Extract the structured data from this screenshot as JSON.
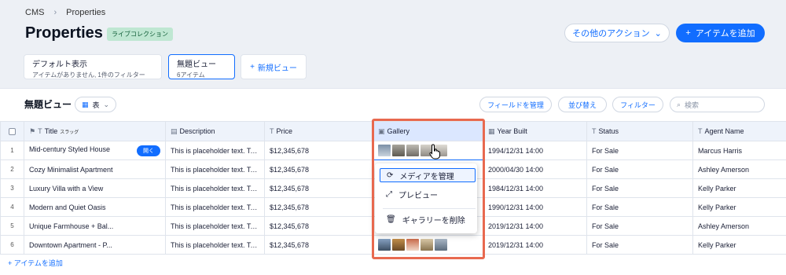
{
  "breadcrumb": [
    "CMS",
    "Properties"
  ],
  "page_title": "Properties",
  "badge": "ライブコレクション",
  "more_actions": "その他のアクション",
  "add_item": "アイテムを追加",
  "views": {
    "default": {
      "title": "デフォルト表示",
      "subtitle": "アイテムがありません, 1件のフィルター"
    },
    "current": {
      "title": "無題ビュー",
      "subtitle": "6アイテム"
    },
    "new_view": "新規ビュー"
  },
  "toolbar": {
    "view_name": "無題ビュー",
    "view_type": "表",
    "manage_fields": "フィールドを管理",
    "sort": "並び替え",
    "filter": "フィルター",
    "search_placeholder": "検索"
  },
  "columns": {
    "title": "Title",
    "slug": "スラッグ",
    "description": "Description",
    "price": "Price",
    "gallery": "Gallery",
    "year_built": "Year Built",
    "status": "Status",
    "agent_name": "Agent Name"
  },
  "rows": [
    {
      "num": "1",
      "title": "Mid-century Styled House",
      "description": "This is placeholder text. To...",
      "price": "$12,345,678",
      "year": "1994/12/31 14:00",
      "status": "For Sale",
      "agent": "Marcus Harris"
    },
    {
      "num": "2",
      "title": "Cozy Minimalist Apartment",
      "description": "This is placeholder text. To...",
      "price": "$12,345,678",
      "year": "2000/04/30 14:00",
      "status": "For Sale",
      "agent": "Ashley Amerson"
    },
    {
      "num": "3",
      "title": "Luxury Villa with a View",
      "description": "This is placeholder text. To...",
      "price": "$12,345,678",
      "year": "1984/12/31 14:00",
      "status": "For Sale",
      "agent": "Kelly Parker"
    },
    {
      "num": "4",
      "title": "Modern and Quiet Oasis",
      "description": "This is placeholder text. To...",
      "price": "$12,345,678",
      "year": "1990/12/31 14:00",
      "status": "For Sale",
      "agent": "Kelly Parker"
    },
    {
      "num": "5",
      "title": "Unique Farmhouse + Bal...",
      "description": "This is placeholder text. To...",
      "price": "$12,345,678",
      "year": "2019/12/31 14:00",
      "status": "For Sale",
      "agent": "Ashley Amerson"
    },
    {
      "num": "6",
      "title": "Downtown Apartment - P...",
      "description": "This is placeholder text. To...",
      "price": "$12,345,678",
      "year": "2019/12/31 14:00",
      "status": "For Sale",
      "agent": "Kelly Parker"
    }
  ],
  "open_button": "開く",
  "add_row": "アイテムを追加",
  "gallery_menu": {
    "manage_media": "メディアを管理",
    "preview": "プレビュー",
    "delete_gallery": "ギャラリーを削除"
  }
}
